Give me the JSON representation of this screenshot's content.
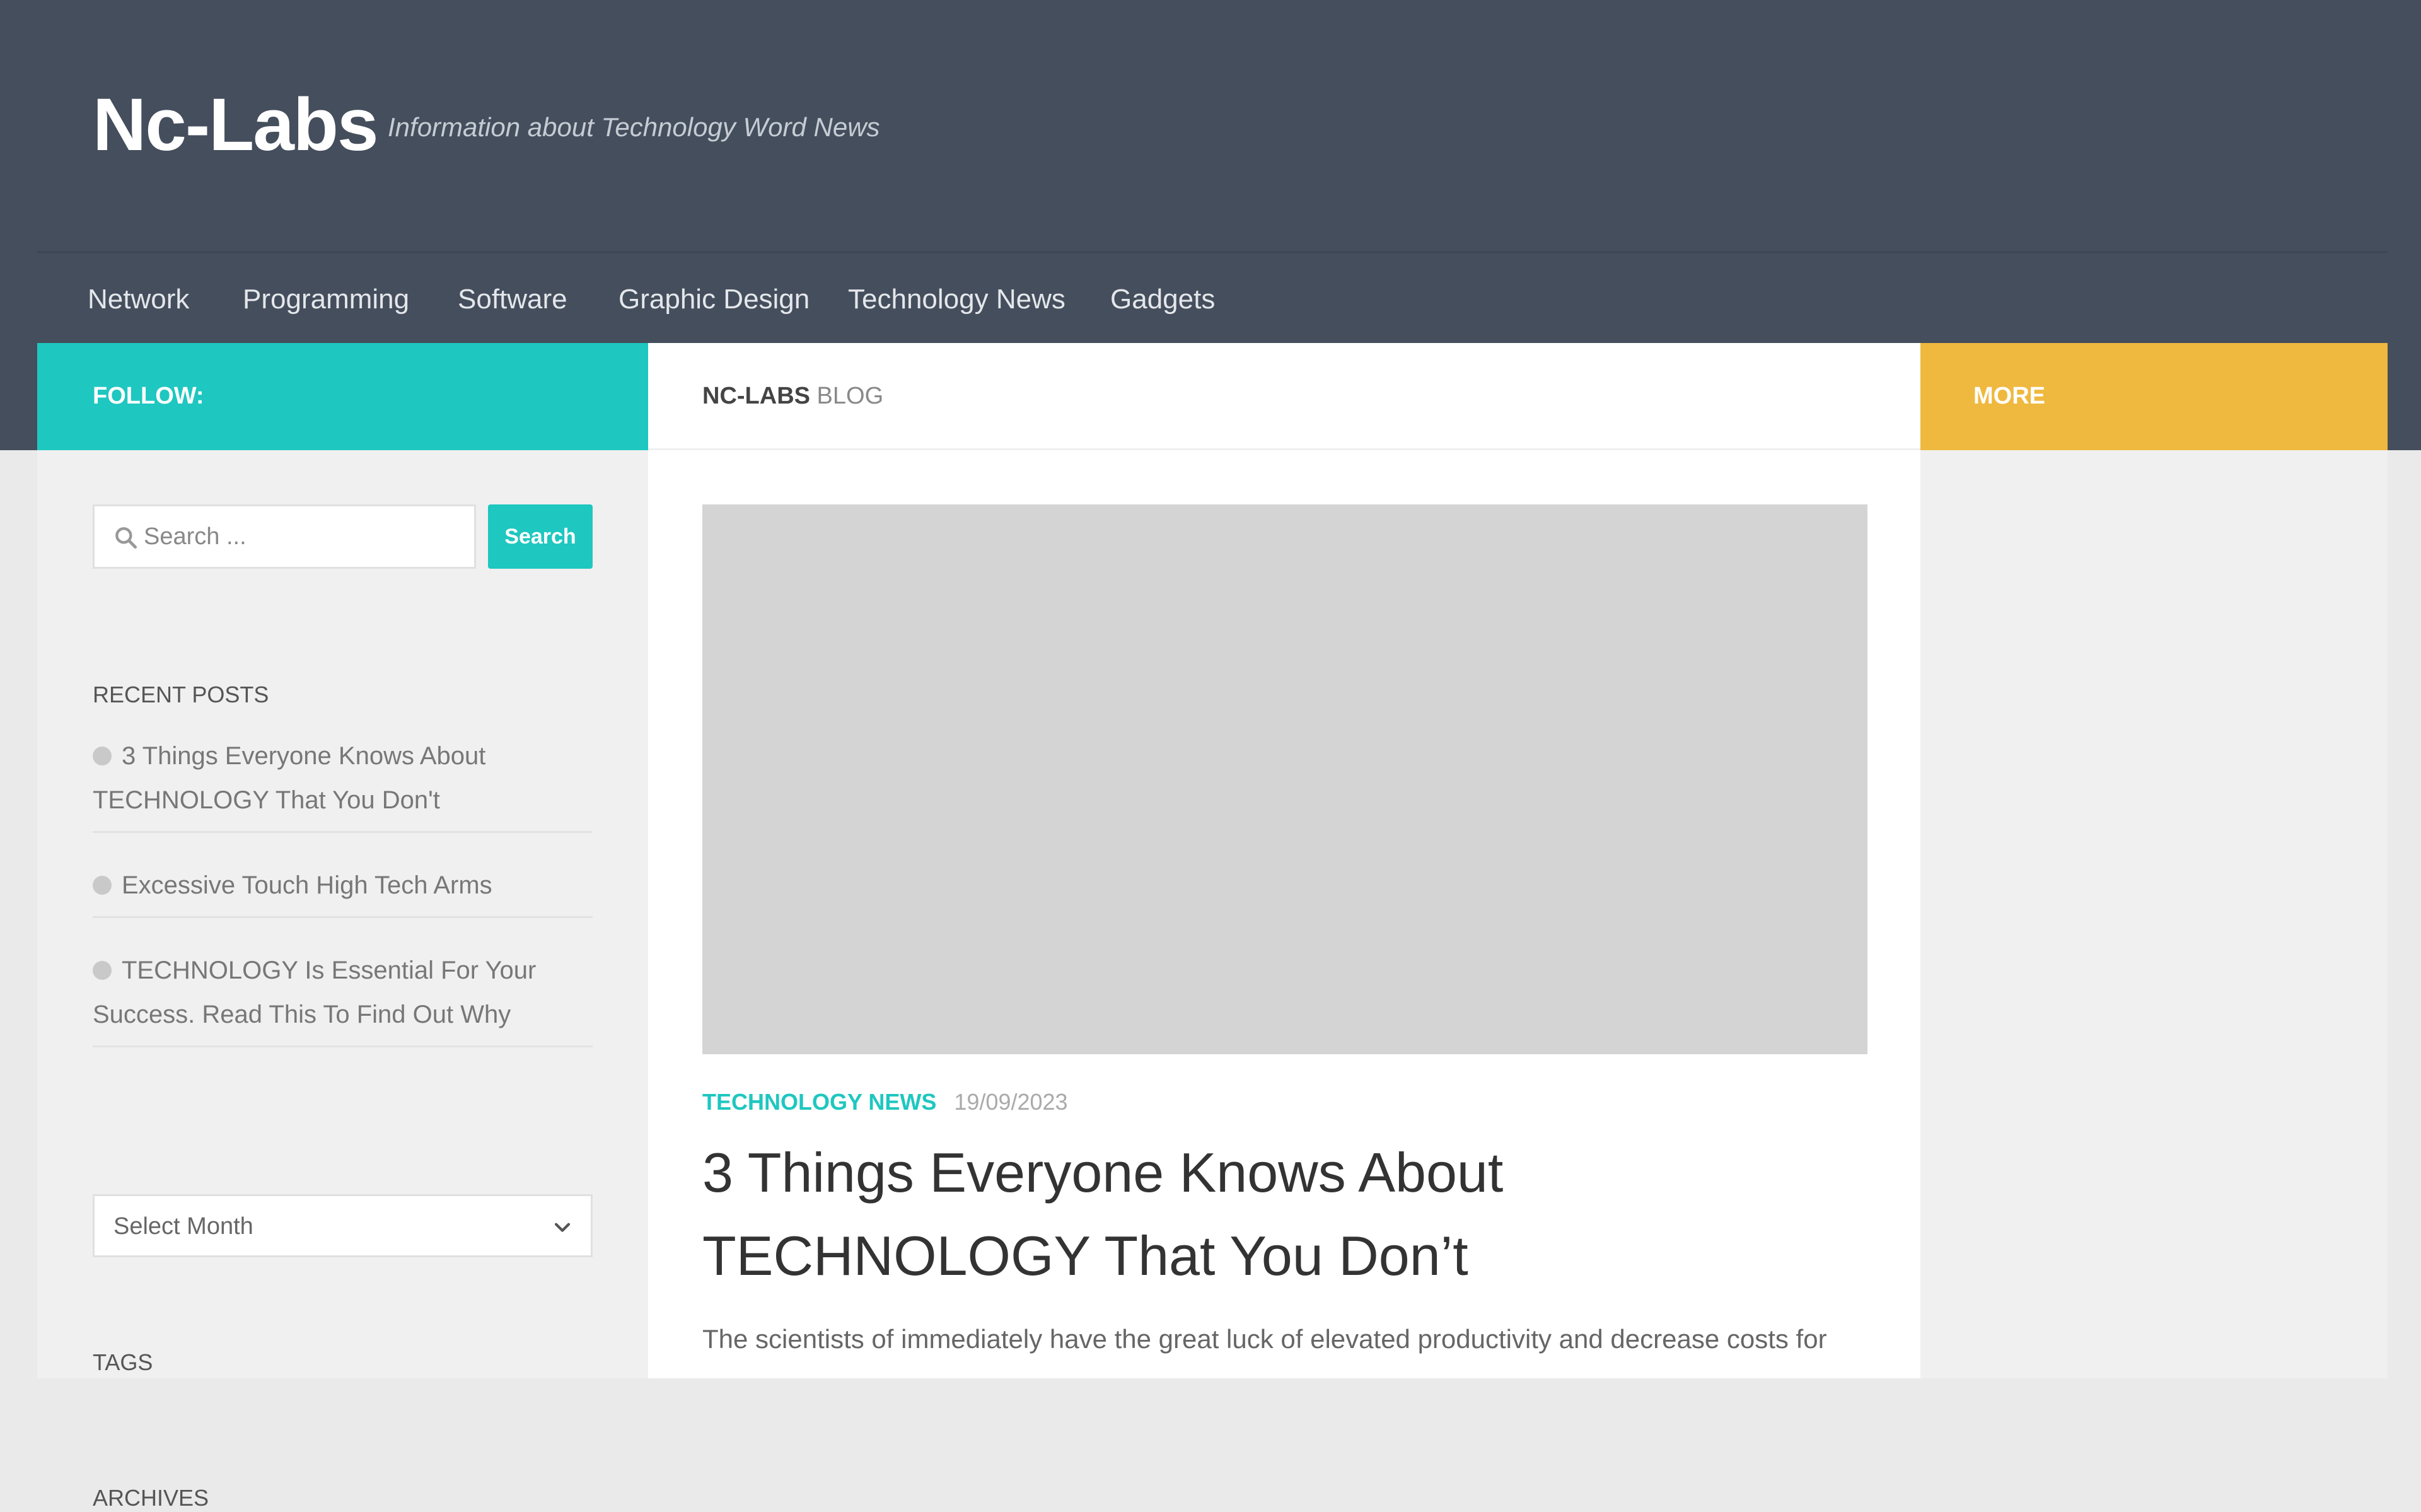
{
  "header": {
    "site_title": "Nc-Labs",
    "tagline": "Information about Technology Word News",
    "background_color": "#454e5c"
  },
  "nav": {
    "items": [
      {
        "label": "Network"
      },
      {
        "label": "Programming"
      },
      {
        "label": "Software"
      },
      {
        "label": "Graphic Design"
      },
      {
        "label": "Technology News"
      },
      {
        "label": "Gadgets"
      }
    ]
  },
  "sidebar_left": {
    "follow_label": "FOLLOW:",
    "accent_color": "#1ec7c0",
    "search": {
      "placeholder": "Search ...",
      "button_label": "Search",
      "icon": "search-icon"
    },
    "recent_posts": {
      "title": "RECENT POSTS",
      "items": [
        {
          "label": "3 Things Everyone Knows About TECHNOLOGY That You Don't"
        },
        {
          "label": "Excessive Touch High Tech Arms"
        },
        {
          "label": "TECHNOLOGY Is Essential For Your Success. Read This To Find Out Why"
        }
      ]
    },
    "archives": {
      "title": "ARCHIVES",
      "selected": "Select Month",
      "icon": "chevron-down-icon"
    },
    "tags_title": "TAGS"
  },
  "main": {
    "heading_strong": "NC-LABS",
    "heading_light": "BLOG",
    "post": {
      "category": "TECHNOLOGY NEWS",
      "date": "19/09/2023",
      "title": "3 Things Everyone Knows About TECHNOLOGY That You Don’t",
      "excerpt": "The scientists of immediately have the great luck of elevated productivity and decrease costs for"
    }
  },
  "sidebar_right": {
    "more_label": "MORE",
    "accent_color": "#efb93f"
  }
}
